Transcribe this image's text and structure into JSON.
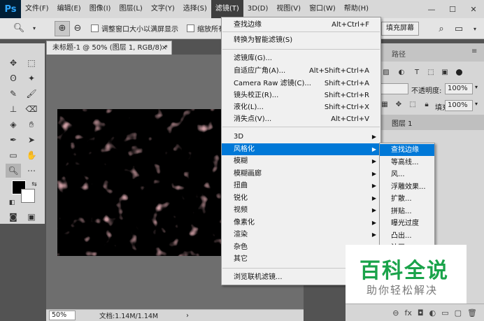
{
  "app": {
    "logo": "Ps"
  },
  "menubar": {
    "items": [
      "文件(F)",
      "编辑(E)",
      "图像(I)",
      "图层(L)",
      "文字(Y)",
      "选择(S)",
      "滤镜(T)",
      "3D(D)",
      "视图(V)",
      "窗口(W)",
      "帮助(H)"
    ],
    "active_index": 6
  },
  "window_controls": {
    "minimize": "—",
    "maximize": "☐",
    "close": "✕"
  },
  "options_bar": {
    "tool_icon": "zoom-icon",
    "checkbox1_label": "调整窗口大小以满屏显示",
    "checkbox2_label": "缩放所有",
    "fill_screen_label": "填充屏幕"
  },
  "document": {
    "tab_title": "未标题-1 @ 50% (图层 1, RGB/8) *",
    "tab_close": "×",
    "zoom": "50%",
    "doc_info": "文档:1.14M/1.14M"
  },
  "right_panel": {
    "tab_paths": "路径",
    "opacity_label": "不透明度:",
    "opacity_value": "100%",
    "fill_label": "填充:",
    "fill_value": "100%",
    "layer_name": "图层 1"
  },
  "filter_menu": {
    "items": [
      {
        "label": "查找边缘",
        "shortcut": "Alt+Ctrl+F"
      },
      {
        "label": "转换为智能滤镜(S)",
        "shortcut": ""
      },
      {
        "label": "滤镜库(G)...",
        "shortcut": ""
      },
      {
        "label": "自适应广角(A)...",
        "shortcut": "Alt+Shift+Ctrl+A"
      },
      {
        "label": "Camera Raw 滤镜(C)...",
        "shortcut": "Shift+Ctrl+A"
      },
      {
        "label": "镜头校正(R)...",
        "shortcut": "Shift+Ctrl+R"
      },
      {
        "label": "液化(L)...",
        "shortcut": "Shift+Ctrl+X"
      },
      {
        "label": "消失点(V)...",
        "shortcut": "Alt+Ctrl+V"
      },
      {
        "label": "3D",
        "shortcut": ""
      },
      {
        "label": "风格化",
        "shortcut": ""
      },
      {
        "label": "模糊",
        "shortcut": ""
      },
      {
        "label": "模糊画廊",
        "shortcut": ""
      },
      {
        "label": "扭曲",
        "shortcut": ""
      },
      {
        "label": "锐化",
        "shortcut": ""
      },
      {
        "label": "视频",
        "shortcut": ""
      },
      {
        "label": "像素化",
        "shortcut": ""
      },
      {
        "label": "渲染",
        "shortcut": ""
      },
      {
        "label": "杂色",
        "shortcut": ""
      },
      {
        "label": "其它",
        "shortcut": ""
      },
      {
        "label": "浏览联机滤镜...",
        "shortcut": ""
      }
    ],
    "highlighted_index": 9,
    "arrow": "▶"
  },
  "stylize_submenu": {
    "items": [
      "查找边缘",
      "等高线...",
      "风...",
      "浮雕效果...",
      "扩散...",
      "拼贴...",
      "曝光过度",
      "凸出...",
      "油画..."
    ],
    "highlighted_index": 0
  },
  "watermark": {
    "title": "百科全说",
    "subtitle": "助你轻松解决"
  },
  "layer_bar_icons": [
    "link-icon",
    "fx-icon",
    "mask-icon",
    "adjustment-icon",
    "group-icon",
    "new-layer-icon",
    "trash-icon"
  ],
  "layer_bar_glyphs": [
    "⊖",
    "fx",
    "◘",
    "◐",
    "▭",
    "▢",
    "🗑"
  ]
}
